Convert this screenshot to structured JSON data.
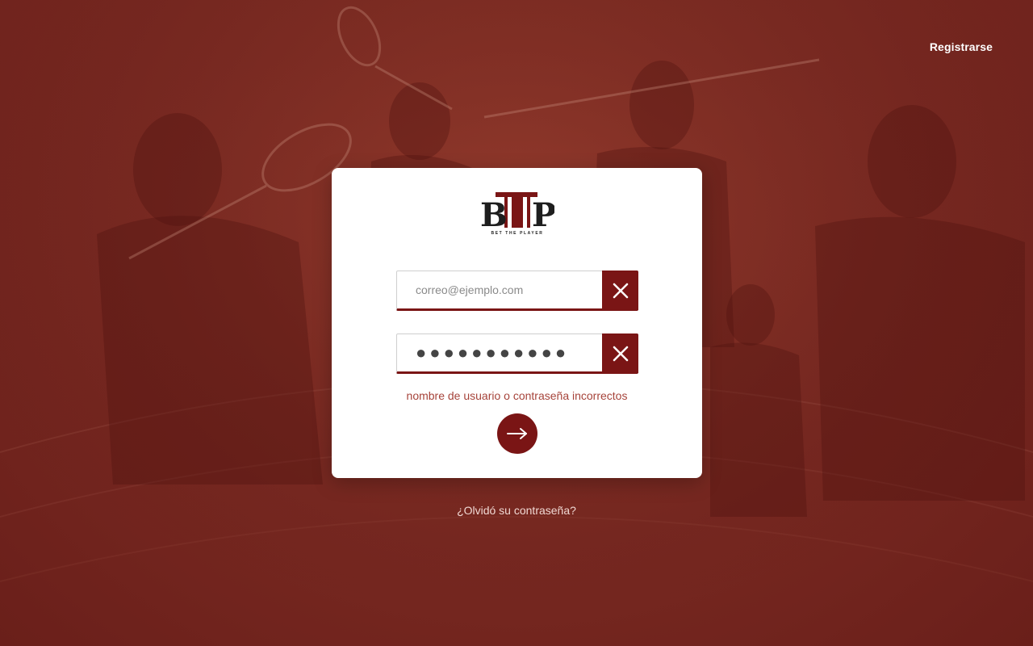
{
  "header": {
    "register_label": "Registrarse"
  },
  "logo": {
    "text": "BTP",
    "tagline": "BET THE PLAYER"
  },
  "login_form": {
    "email_placeholder": "correo@ejemplo.com",
    "email_value": "",
    "password_value": "●●●●●●●●●●●",
    "error_message": "nombre de usuario o contraseña incorrectos",
    "clear_icon": "close-icon",
    "submit_icon": "arrow-right-icon"
  },
  "footer": {
    "forgot_password_label": "¿Olvidó su contraseña?"
  },
  "colors": {
    "brand": "#7a1515",
    "background": "#7a2a22",
    "error": "#a6433a"
  }
}
